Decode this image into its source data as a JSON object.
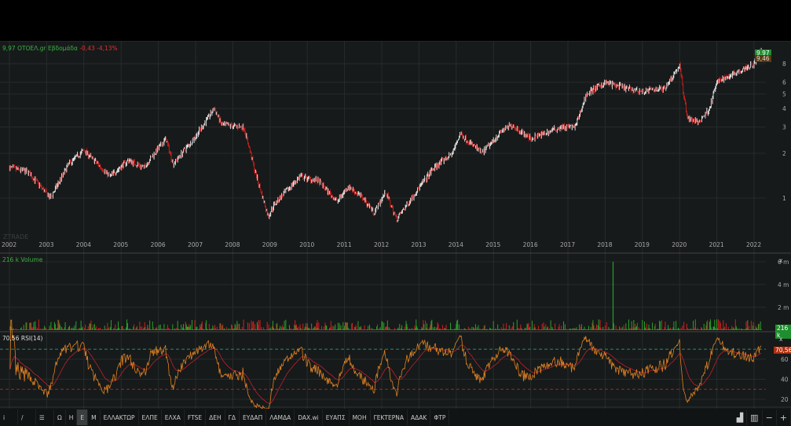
{
  "header": {
    "price": "9,97",
    "symbol": "ΟΤΟΕΛ.gr",
    "period": "Εβδομάδα",
    "change": "-0,43",
    "change_pct": "-4,13%"
  },
  "watermark": "ZTRADE",
  "price_axis": {
    "last": "9,97",
    "prev": "9,46",
    "ticks": [
      "8",
      "6",
      "5",
      "4",
      "3",
      "2",
      "1"
    ]
  },
  "years": [
    "2002",
    "2003",
    "2004",
    "2005",
    "2006",
    "2007",
    "2008",
    "2009",
    "2010",
    "2011",
    "2012",
    "2013",
    "2014",
    "2015",
    "2016",
    "2017",
    "2018",
    "2019",
    "2020",
    "2021",
    "2022"
  ],
  "volume": {
    "label": "216 k Volume",
    "last": "216 k",
    "ticks": [
      "6 m",
      "4 m",
      "2 m"
    ],
    "close": "x"
  },
  "rsi": {
    "label": "70,56 RSI(14)",
    "last": "70,56",
    "ticks": [
      "60",
      "40",
      "20"
    ],
    "close": "x"
  },
  "colors": {
    "up": "#ffffff",
    "down": "#e02020",
    "vol_up": "#2aa02a",
    "vol_down": "#d02020",
    "rsi": "#e08020",
    "rsi_ma": "#c02030",
    "last_tag": "#1e8e2e"
  },
  "chart_data": {
    "type": "line",
    "scale": "log",
    "x_unit": "year",
    "price_points": [
      [
        2002.0,
        1.6
      ],
      [
        2002.5,
        1.5
      ],
      [
        2003.1,
        1.0
      ],
      [
        2003.6,
        1.7
      ],
      [
        2004.0,
        2.1
      ],
      [
        2004.7,
        1.4
      ],
      [
        2005.2,
        1.8
      ],
      [
        2005.6,
        1.6
      ],
      [
        2006.2,
        2.5
      ],
      [
        2006.4,
        1.7
      ],
      [
        2007.0,
        2.6
      ],
      [
        2007.5,
        4.0
      ],
      [
        2007.7,
        3.1
      ],
      [
        2008.3,
        3.0
      ],
      [
        2008.6,
        1.5
      ],
      [
        2008.95,
        0.75
      ],
      [
        2009.1,
        0.9
      ],
      [
        2009.8,
        1.4
      ],
      [
        2010.3,
        1.3
      ],
      [
        2010.8,
        0.95
      ],
      [
        2011.1,
        1.2
      ],
      [
        2011.5,
        1.0
      ],
      [
        2011.8,
        0.8
      ],
      [
        2012.1,
        1.1
      ],
      [
        2012.4,
        0.72
      ],
      [
        2012.8,
        1.0
      ],
      [
        2013.4,
        1.6
      ],
      [
        2013.9,
        2.0
      ],
      [
        2014.1,
        2.7
      ],
      [
        2014.7,
        2.0
      ],
      [
        2015.2,
        2.8
      ],
      [
        2015.5,
        3.1
      ],
      [
        2016.0,
        2.5
      ],
      [
        2016.8,
        3.0
      ],
      [
        2017.2,
        3.0
      ],
      [
        2017.5,
        5.0
      ],
      [
        2018.0,
        6.0
      ],
      [
        2018.5,
        5.5
      ],
      [
        2019.0,
        5.2
      ],
      [
        2019.6,
        5.5
      ],
      [
        2020.0,
        7.8
      ],
      [
        2020.2,
        3.5
      ],
      [
        2020.5,
        3.2
      ],
      [
        2020.8,
        4.0
      ],
      [
        2021.0,
        6.0
      ],
      [
        2021.5,
        7.0
      ],
      [
        2022.0,
        8.0
      ],
      [
        2022.2,
        9.97
      ]
    ],
    "volume_spike": {
      "x": 2018.2,
      "value_m": 6.0
    }
  },
  "toolbar": [
    "i",
    "/",
    "☰",
    "Ω",
    "Η",
    "Ε",
    "Μ",
    "ΕΛΛΑΚΤΩΡ",
    "ΕΛΠΕ",
    "ΕΛΧΑ",
    "FTSE",
    "ΔΕΗ",
    "ΓΔ",
    "ΕΥΔΑΠ",
    "ΛΑΜΔΑ",
    "DAX.wi",
    "ΕΥΑΠΣ",
    "ΜΟΗ",
    "ΓΕΚΤΕΡΝΑ",
    "ΑΔΑΚ",
    "ΦΤΡ"
  ],
  "toolbar_right": [
    "chart-type",
    "indicators",
    "−",
    "+"
  ]
}
